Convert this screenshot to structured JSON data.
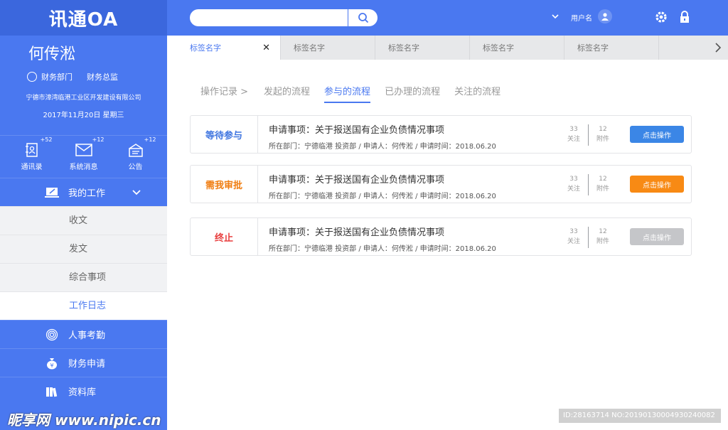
{
  "app": {
    "logo": "讯通OA"
  },
  "profile": {
    "name": "何传淞",
    "department": "财务部门",
    "position": "财务总监",
    "company": "宁德市漳湾临港工业区开发建设有限公司",
    "date": "2017年11月20日 星期三"
  },
  "quick": [
    {
      "label": "通讯录",
      "badge": "+52",
      "icon": "contacts-icon"
    },
    {
      "label": "系统消息",
      "badge": "+12",
      "icon": "mail-icon"
    },
    {
      "label": "公告",
      "badge": "+12",
      "icon": "announcement-icon"
    }
  ],
  "menu": {
    "my_work": "我的工作",
    "sub": [
      "收文",
      "发文",
      "综合事项",
      "工作日志"
    ],
    "items": [
      "人事考勤",
      "财务申请",
      "资料库"
    ]
  },
  "topbar": {
    "search_placeholder": "",
    "username": "用户名"
  },
  "tabs": [
    "标签名字",
    "标签名字",
    "标签名字",
    "标签名字",
    "标签名字"
  ],
  "subnav": {
    "crumb": "操作记录 >",
    "items": [
      "发起的流程",
      "参与的流程",
      "已办理的流程",
      "关注的流程"
    ],
    "active_index": 1
  },
  "cards": [
    {
      "status": "等待参与",
      "status_color": "#3f75e0",
      "title": "申请事项：关于报送国有企业负债情况事项",
      "meta": "所在部门：宁德临港 投资部 / 申请人：何传淞 / 申请时间：2018.06.20",
      "follow_count": "33",
      "follow_label": "关注",
      "attach_count": "12",
      "attach_label": "附件",
      "action": "点击操作",
      "action_color": "#3b86e6"
    },
    {
      "status": "需我审批",
      "status_color": "#f07e12",
      "title": "申请事项：关于报送国有企业负债情况事项",
      "meta": "所在部门：宁德临港 投资部 / 申请人：何传淞 / 申请时间：2018.06.20",
      "follow_count": "33",
      "follow_label": "关注",
      "attach_count": "12",
      "attach_label": "附件",
      "action": "点击操作",
      "action_color": "#f88a14"
    },
    {
      "status": "终止",
      "status_color": "#e83e3e",
      "title": "申请事项：关于报送国有企业负债情况事项",
      "meta": "所在部门：宁德临港 投资部 / 申请人：何传淞 / 申请时间：2018.06.20",
      "follow_count": "33",
      "follow_label": "关注",
      "attach_count": "12",
      "attach_label": "附件",
      "action": "点击操作",
      "action_color": "#c5c6c9"
    }
  ],
  "watermark": {
    "left": "昵享网 www.nipic.cn",
    "right": "ID:28163714 NO:20190130004930240082"
  }
}
